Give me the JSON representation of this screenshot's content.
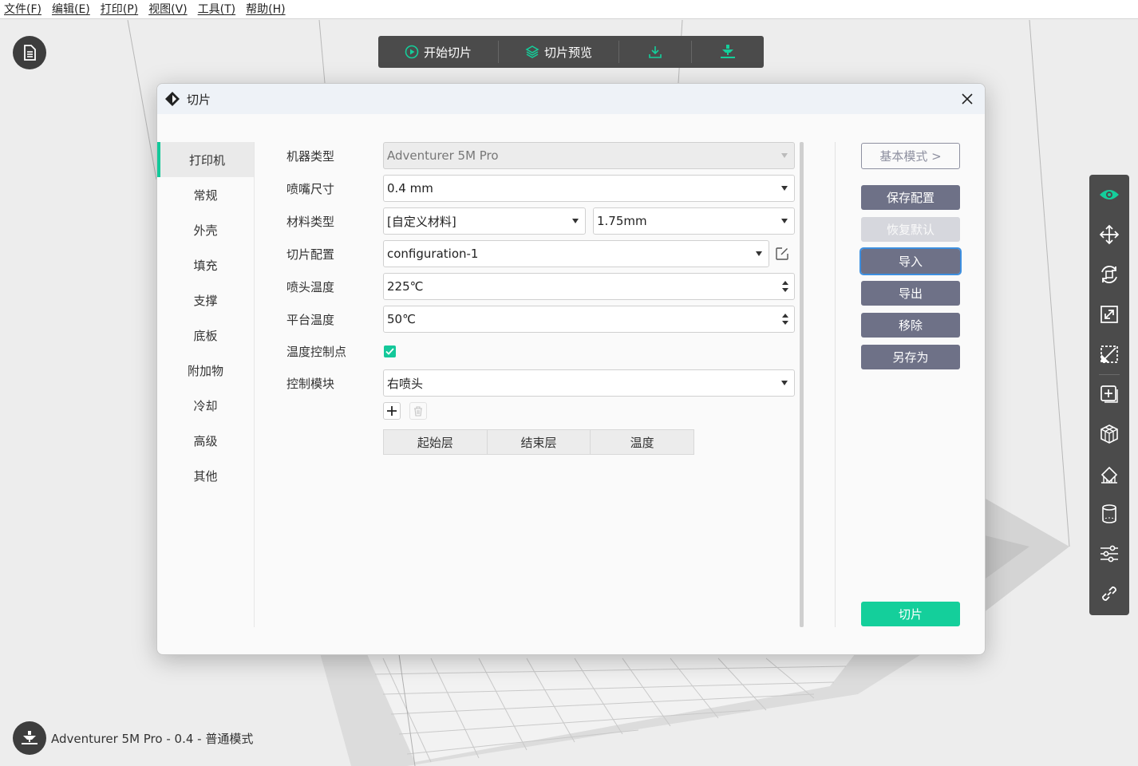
{
  "menu": [
    "文件(F)",
    "编辑(E)",
    "打印(P)",
    "视图(V)",
    "工具(T)",
    "帮助(H)"
  ],
  "toolbar": {
    "start_slice": "开始切片",
    "slice_preview": "切片预览"
  },
  "dialog": {
    "title": "切片",
    "nav": [
      "打印机",
      "常规",
      "外壳",
      "填充",
      "支撑",
      "底板",
      "附加物",
      "冷却",
      "高级",
      "其他"
    ],
    "labels": {
      "machine_type": "机器类型",
      "nozzle_size": "喷嘴尺寸",
      "material_type": "材料类型",
      "slice_config": "切片配置",
      "nozzle_temp": "喷头温度",
      "bed_temp": "平台温度",
      "temp_control_point": "温度控制点",
      "control_module": "控制模块"
    },
    "values": {
      "machine_type": "Adventurer 5M Pro",
      "nozzle_size": "0.4 mm",
      "material": "[自定义材料]",
      "filament_diameter": "1.75mm",
      "slice_config": "configuration-1",
      "nozzle_temp": "225℃",
      "bed_temp": "50℃",
      "temp_control_point_checked": true,
      "control_module": "右喷头"
    },
    "table_headers": [
      "起始层",
      "结束层",
      "温度"
    ],
    "buttons": {
      "basic_mode": "基本模式 >",
      "save_config": "保存配置",
      "restore_default": "恢复默认",
      "import": "导入",
      "export": "导出",
      "remove": "移除",
      "save_as": "另存为",
      "slice": "切片"
    }
  },
  "status": {
    "printer_text": "Adventurer 5M Pro - 0.4 - 普通模式"
  },
  "colors": {
    "accent": "#14cf9b",
    "button": "#6e7187",
    "toolbar": "#4b4b4b"
  }
}
